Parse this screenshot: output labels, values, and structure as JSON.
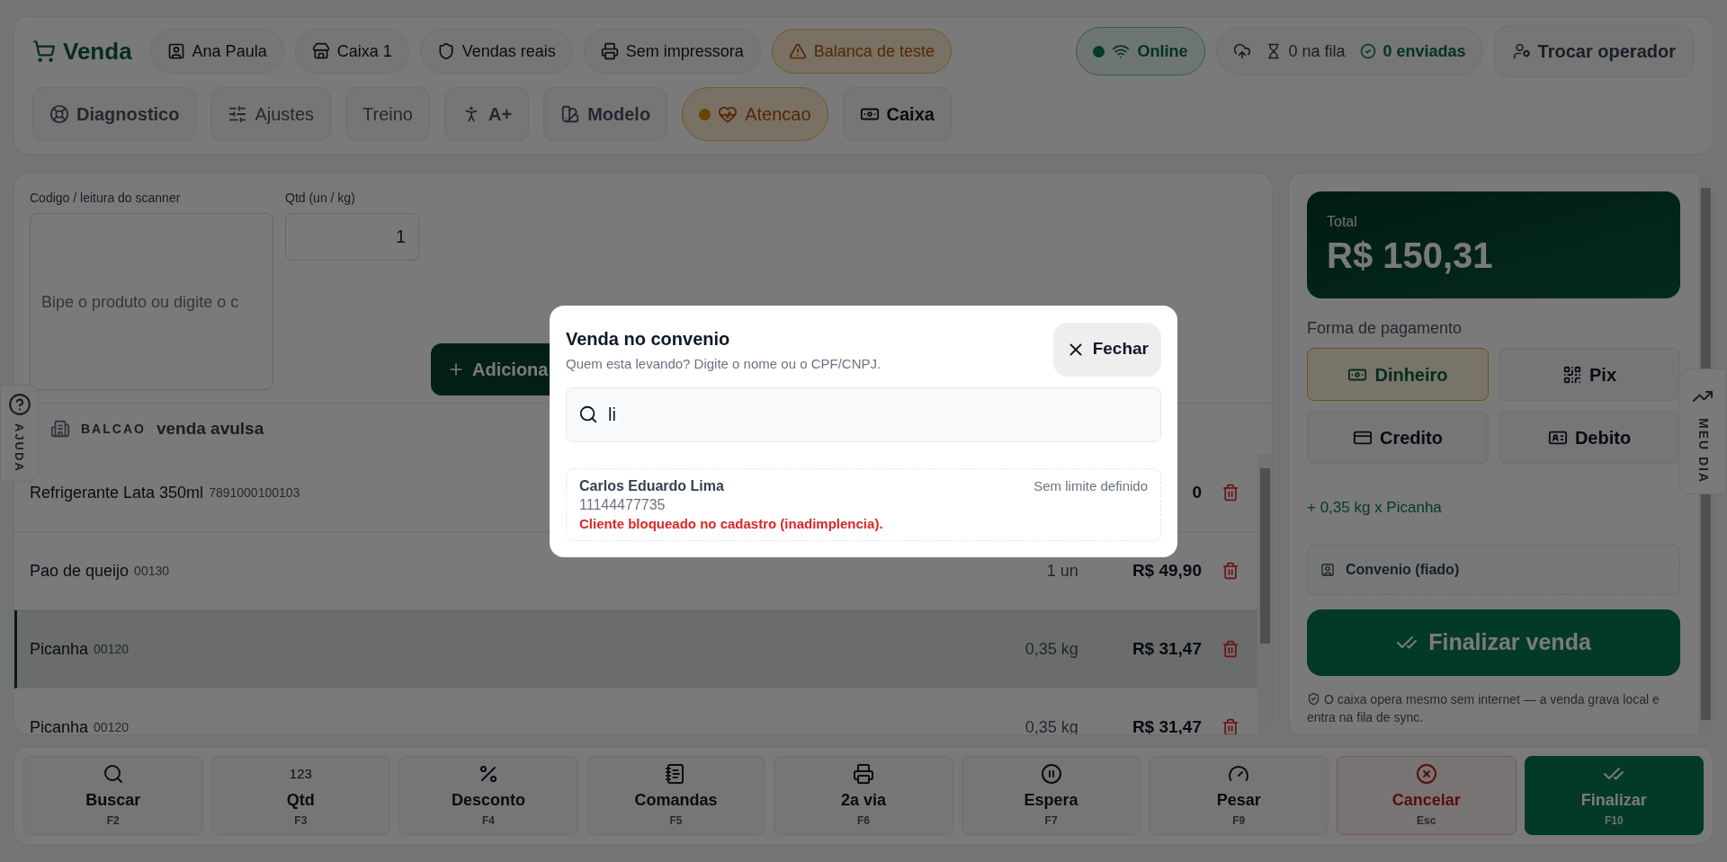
{
  "header": {
    "title": "Venda",
    "chips": [
      {
        "kind": "operator",
        "label": "Ana Paula",
        "warning": false
      },
      {
        "kind": "register",
        "label": "Caixa 1",
        "warning": false
      },
      {
        "kind": "mode",
        "label": "Vendas reais",
        "warning": false
      },
      {
        "kind": "printer",
        "label": "Sem impressora",
        "warning": false
      },
      {
        "kind": "scale",
        "label": "Balanca de teste",
        "warning": true
      }
    ],
    "online": {
      "label": "Online"
    },
    "queue": {
      "pending": "0 na fila",
      "sent": "0 enviadas"
    },
    "switch_operator": "Trocar operador"
  },
  "tools": [
    {
      "kind": "diagnostics",
      "label": "Diagnostico",
      "warning": false
    },
    {
      "kind": "settings",
      "label": "Ajustes",
      "warning": false
    },
    {
      "kind": "training",
      "label": "Treino",
      "warning": false
    },
    {
      "kind": "accessibility",
      "label": "A+",
      "warning": false
    },
    {
      "kind": "theme",
      "label": "Modelo",
      "warning": false
    },
    {
      "kind": "health",
      "label": "Atencao",
      "warning": true
    },
    {
      "kind": "cash",
      "label": "Caixa",
      "warning": false
    }
  ],
  "scanner": {
    "label": "Codigo / leitura do scanner",
    "placeholder": "Bipe o produto ou digite o c"
  },
  "quantity": {
    "label": "Qtd (un / kg)",
    "value": "1"
  },
  "add_button": "Adiciona",
  "customer": {
    "tag": "BALCAO",
    "name": "venda avulsa"
  },
  "items": [
    {
      "name": "Refrigerante Lata 350ml",
      "code": "7891000100103",
      "price": "0",
      "selected": false
    },
    {
      "name": "Pao de queijo",
      "code": "00130",
      "qty": "1 un",
      "price": "R$ 49,90",
      "selected": false
    },
    {
      "name": "Picanha",
      "code": "00120",
      "qty": "0,35 kg",
      "price": "R$ 31,47",
      "selected": true
    },
    {
      "name": "Picanha",
      "code": "00120",
      "qty": "0,35 kg",
      "price": "R$ 31,47",
      "selected": false
    }
  ],
  "help_tab": "AJUDA",
  "day_tab": "MEU DIA",
  "total": {
    "label": "Total",
    "value": "R$ 150,31"
  },
  "payment": {
    "label": "Forma de pagamento",
    "methods": [
      {
        "kind": "cash",
        "label": "Dinheiro",
        "selected": true
      },
      {
        "kind": "pix",
        "label": "Pix",
        "selected": false
      },
      {
        "kind": "credit",
        "label": "Credito",
        "selected": false
      },
      {
        "kind": "debit",
        "label": "Debito",
        "selected": false
      }
    ]
  },
  "last_added": "+ 0,35 kg x Picanha",
  "credit_sale": "Convenio (fiado)",
  "finish_sale": "Finalizar venda",
  "offline_note": "O caixa opera mesmo sem internet — a venda grava local e entra na fila de sync.",
  "shortcuts": [
    {
      "kind": "search",
      "label": "Buscar",
      "key": "F2"
    },
    {
      "kind": "number",
      "glyph": "123",
      "label": "Qtd",
      "key": "F3"
    },
    {
      "kind": "percent",
      "label": "Desconto",
      "key": "F4"
    },
    {
      "kind": "orders",
      "label": "Comandas",
      "key": "F5"
    },
    {
      "kind": "print",
      "label": "2a via",
      "key": "F6"
    },
    {
      "kind": "pause",
      "label": "Espera",
      "key": "F7"
    },
    {
      "kind": "weigh",
      "label": "Pesar",
      "key": "F9"
    },
    {
      "kind": "cancel",
      "label": "Cancelar",
      "key": "Esc"
    },
    {
      "kind": "finish",
      "label": "Finalizar",
      "key": "F10"
    }
  ],
  "dialog": {
    "title": "Venda no convenio",
    "subtitle": "Quem esta levando? Digite o nome ou o CPF/CNPJ.",
    "close": "Fechar",
    "search_value": "li",
    "results": [
      {
        "name": "Carlos Eduardo Lima",
        "document": "11144477735",
        "limit": "Sem limite definido",
        "alert": "Cliente bloqueado no cadastro (inadimplencia)."
      }
    ]
  }
}
